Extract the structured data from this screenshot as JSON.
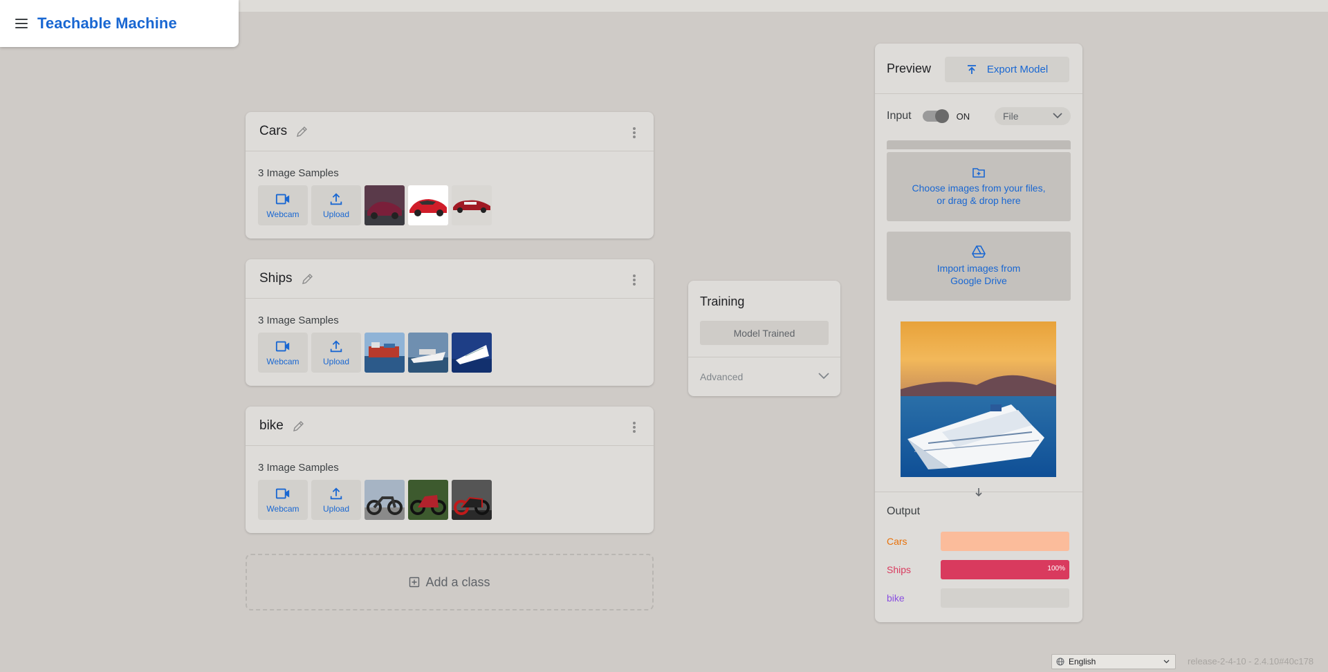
{
  "app": {
    "title": "Teachable Machine"
  },
  "classes": [
    {
      "name": "Cars",
      "samples_label": "3 Image Samples",
      "webcam_label": "Webcam",
      "upload_label": "Upload"
    },
    {
      "name": "Ships",
      "samples_label": "3 Image Samples",
      "webcam_label": "Webcam",
      "upload_label": "Upload"
    },
    {
      "name": "bike",
      "samples_label": "3 Image Samples",
      "webcam_label": "Webcam",
      "upload_label": "Upload"
    }
  ],
  "add_class": {
    "label": "Add a class"
  },
  "training": {
    "title": "Training",
    "button_label": "Model Trained",
    "advanced_label": "Advanced"
  },
  "preview": {
    "title": "Preview",
    "export_label": "Export Model",
    "input_label": "Input",
    "toggle_state": "ON",
    "source_select": "File",
    "choose_line1": "Choose images from your files,",
    "choose_line2": "or drag & drop here",
    "drive_line1": "Import images from",
    "drive_line2": "Google Drive",
    "output_title": "Output",
    "outputs": [
      {
        "label": "Cars",
        "percent": 0,
        "color": "#e8710a",
        "track": "#fbbc9b",
        "pct_text": ""
      },
      {
        "label": "Ships",
        "percent": 100,
        "color": "#d93a5e",
        "track": "#d3d1cd",
        "pct_text": "100%"
      },
      {
        "label": "bike",
        "percent": 0,
        "color": "#8a4fe0",
        "track": "#d3d1cd",
        "pct_text": ""
      }
    ]
  },
  "footer": {
    "language": "English",
    "release": "release-2-4-10 - 2.4.10#40c178"
  },
  "colors": {
    "accent": "#1967d2",
    "background": "#cfcbc7",
    "card": "#dedcd9"
  },
  "icons": [
    "menu-icon",
    "pencil-icon",
    "more-vert-icon",
    "webcam-icon",
    "upload-icon",
    "add-box-icon",
    "chevron-down-icon",
    "export-icon",
    "folder-add-icon",
    "google-drive-icon",
    "arrow-down-icon",
    "globe-icon"
  ]
}
